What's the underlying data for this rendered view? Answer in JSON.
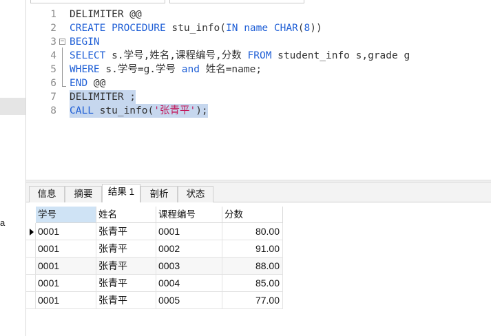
{
  "left_panel": {
    "fragment": "a"
  },
  "editor": {
    "lines": [
      {
        "num": "1",
        "parts": [
          {
            "t": "DELIMITER @@",
            "c": "plain"
          }
        ]
      },
      {
        "num": "2",
        "parts": [
          {
            "t": "CREATE PROCEDURE",
            "c": "kw"
          },
          {
            "t": " stu_info(",
            "c": "plain"
          },
          {
            "t": "IN",
            "c": "kw"
          },
          {
            "t": " name ",
            "c": "kw"
          },
          {
            "t": "CHAR",
            "c": "kw"
          },
          {
            "t": "(",
            "c": "plain"
          },
          {
            "t": "8",
            "c": "kw"
          },
          {
            "t": "))",
            "c": "plain"
          }
        ]
      },
      {
        "num": "3",
        "parts": [
          {
            "t": "BEGIN",
            "c": "kw"
          }
        ]
      },
      {
        "num": "4",
        "parts": [
          {
            "t": "SELECT",
            "c": "kw"
          },
          {
            "t": " s.学号,姓名,课程编号,分数 ",
            "c": "plain"
          },
          {
            "t": "FROM",
            "c": "kw"
          },
          {
            "t": " student_info s,grade g",
            "c": "plain"
          }
        ]
      },
      {
        "num": "5",
        "parts": [
          {
            "t": "WHERE",
            "c": "kw"
          },
          {
            "t": " s.学号=g.学号 ",
            "c": "plain"
          },
          {
            "t": "and",
            "c": "kw"
          },
          {
            "t": " 姓名=name;",
            "c": "plain"
          }
        ]
      },
      {
        "num": "6",
        "parts": [
          {
            "t": "END",
            "c": "kw"
          },
          {
            "t": " @@",
            "c": "plain"
          }
        ]
      },
      {
        "num": "7",
        "parts": [
          {
            "t": "DELIMITER ;",
            "c": "plain"
          }
        ]
      },
      {
        "num": "8",
        "parts": [
          {
            "t": "CALL",
            "c": "kw"
          },
          {
            "t": " stu_info(",
            "c": "plain"
          },
          {
            "t": "'张青平'",
            "c": "str"
          },
          {
            "t": ");",
            "c": "plain"
          }
        ]
      }
    ]
  },
  "tabs": [
    {
      "label": "信息"
    },
    {
      "label": "摘要"
    },
    {
      "label": "结果 1"
    },
    {
      "label": "剖析"
    },
    {
      "label": "状态"
    }
  ],
  "result": {
    "columns": [
      "学号",
      "姓名",
      "课程编号",
      "分数"
    ],
    "rows": [
      [
        "0001",
        "张青平",
        "0001",
        "80.00"
      ],
      [
        "0001",
        "张青平",
        "0002",
        "91.00"
      ],
      [
        "0001",
        "张青平",
        "0003",
        "88.00"
      ],
      [
        "0001",
        "张青平",
        "0004",
        "85.00"
      ],
      [
        "0001",
        "张青平",
        "0005",
        "77.00"
      ]
    ]
  },
  "colors": {
    "keyword": "#1f5fd6",
    "string": "#c2185b",
    "selection": "#c6d7ee",
    "header_selected": "#cfe3f5"
  }
}
